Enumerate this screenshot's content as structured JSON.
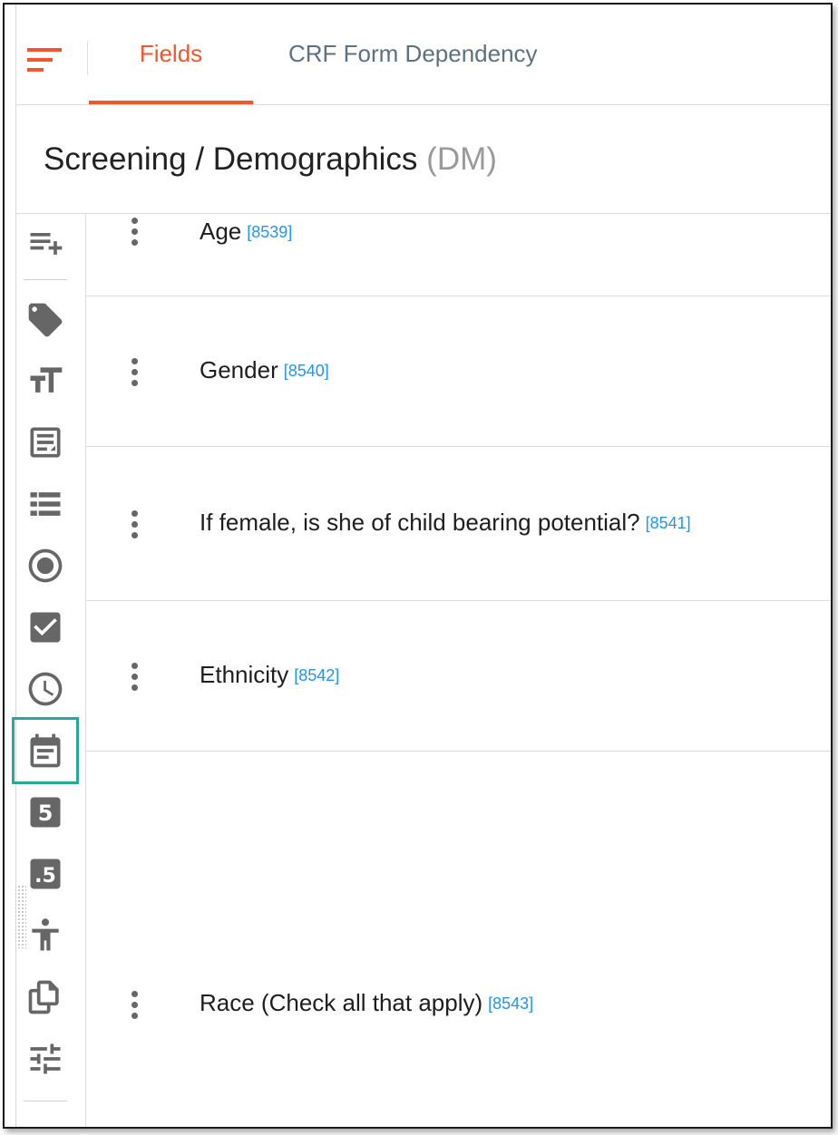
{
  "tabs": [
    {
      "label": "Fields",
      "active": true
    },
    {
      "label": "CRF Form Dependency",
      "active": false
    }
  ],
  "form": {
    "title": "Screening / Demographics",
    "code": "(DM)"
  },
  "toolbox": {
    "icons": [
      "add-field-icon",
      "tag-icon",
      "text-size-icon",
      "text-area-icon",
      "list-icon",
      "radio-icon",
      "checkbox-icon",
      "clock-icon",
      "calendar-icon",
      "integer-icon",
      "decimal-icon",
      "body-figure-icon",
      "copy-icon",
      "sliders-icon"
    ],
    "selected": "calendar-icon",
    "accent_color": "#27a89a"
  },
  "fields": [
    {
      "label": "Age",
      "id": "[8539]"
    },
    {
      "label": "Gender",
      "id": "[8540]"
    },
    {
      "label": "If female, is she of child bearing potential?",
      "id": "[8541]"
    },
    {
      "label": "Ethnicity",
      "id": "[8542]"
    },
    {
      "label": "Race (Check all that apply)",
      "id": "[8543]"
    }
  ],
  "colors": {
    "brand_orange": "#f0572f",
    "tab_inactive": "#5e7180",
    "field_id": "#2196f3",
    "icon_gray": "#666666"
  }
}
